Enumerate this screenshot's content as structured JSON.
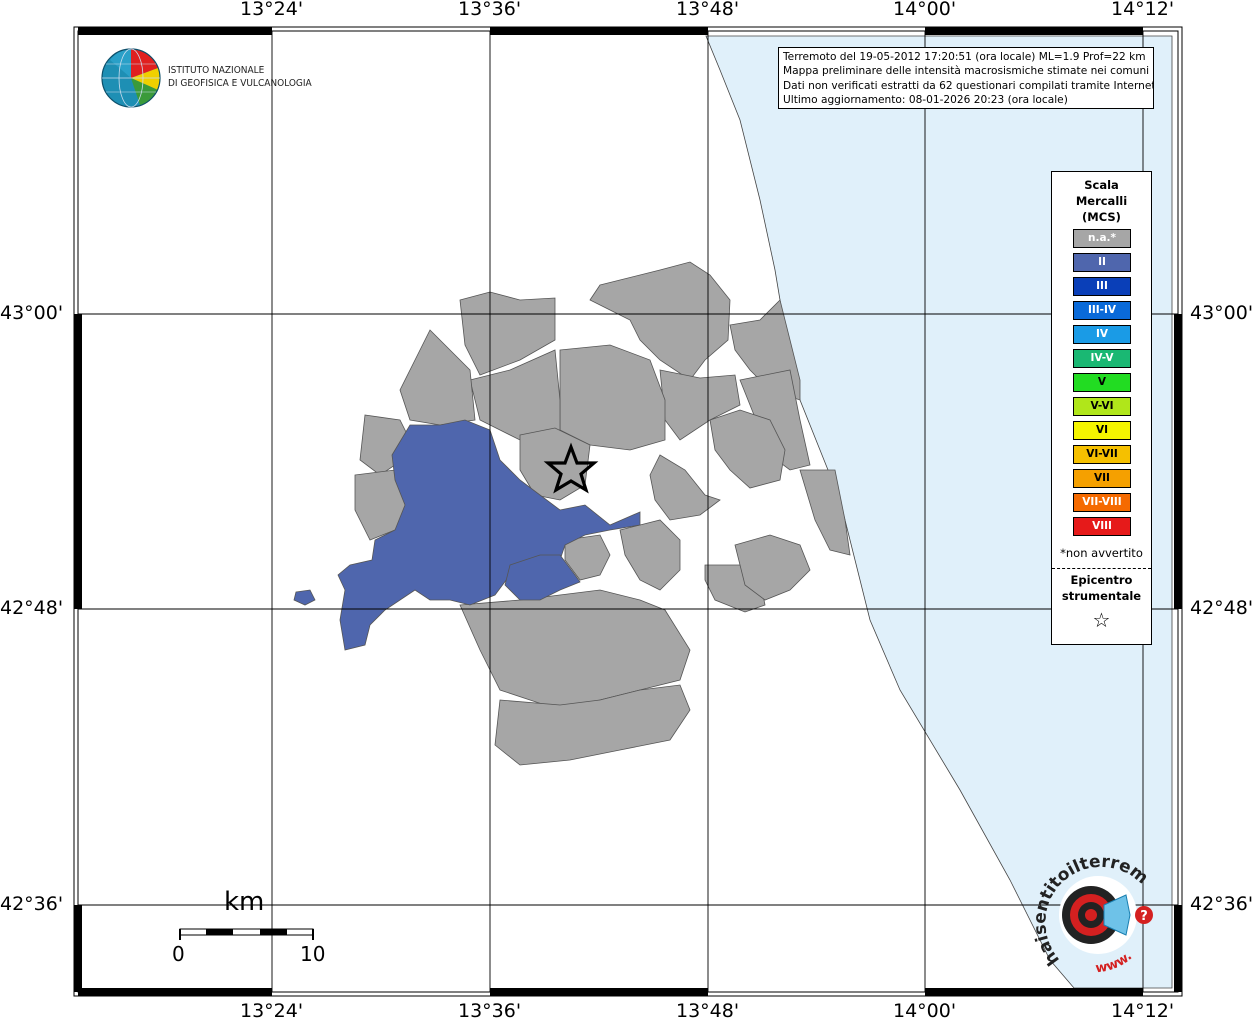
{
  "map": {
    "lon_ticks": [
      "13°24'",
      "13°36'",
      "13°48'",
      "14°00'",
      "14°12'"
    ],
    "lat_ticks": [
      "43°00'",
      "42°48'",
      "42°36'"
    ],
    "colors": {
      "land": "#ffffff",
      "sea": "#e0f0fa",
      "not_felt": "#a6a6a6",
      "intensity_II": "#4f66ad",
      "border": "#555555"
    }
  },
  "logo": {
    "line1": "ISTITUTO NAZIONALE",
    "line2": "DI GEOFISICA E VULCANOLOGIA"
  },
  "info": {
    "line1": "Terremoto del 19-05-2012 17:20:51 (ora locale) ML=1.9 Prof=22 km",
    "line2": "Mappa preliminare delle intensità macrosismiche stimate nei comuni",
    "line3": "Dati non verificati estratti da 62 questionari compilati tramite Internet.",
    "line4": "Ultimo aggiornamento: 08-01-2026 20:23 (ora locale)"
  },
  "legend": {
    "title1": "Scala",
    "title2": "Mercalli",
    "title3": "(MCS)",
    "items": [
      {
        "label": "n.a.*",
        "color": "#a6a6a6"
      },
      {
        "label": "II",
        "color": "#4f66ad"
      },
      {
        "label": "III",
        "color": "#0a3fb8"
      },
      {
        "label": "III-IV",
        "color": "#0a6ad9"
      },
      {
        "label": "IV",
        "color": "#1a9be6"
      },
      {
        "label": "IV-V",
        "color": "#1ab873"
      },
      {
        "label": "V",
        "color": "#22dc22"
      },
      {
        "label": "V-VI",
        "color": "#b0e61a"
      },
      {
        "label": "VI",
        "color": "#f5f500"
      },
      {
        "label": "VI-VII",
        "color": "#f5c000"
      },
      {
        "label": "VII",
        "color": "#f5a000"
      },
      {
        "label": "VII-VIII",
        "color": "#f56a00"
      },
      {
        "label": "VIII",
        "color": "#e61a1a"
      }
    ],
    "note": "*non avvertito",
    "epicenter1": "Epicentro",
    "epicenter2": "strumentale",
    "epicenter_symbol": "☆"
  },
  "scale_bar": {
    "unit": "km",
    "min": "0",
    "max": "10"
  },
  "badge": {
    "text": "haisentitoilterremoto.it",
    "prefix": "www.",
    "mark": "?"
  }
}
